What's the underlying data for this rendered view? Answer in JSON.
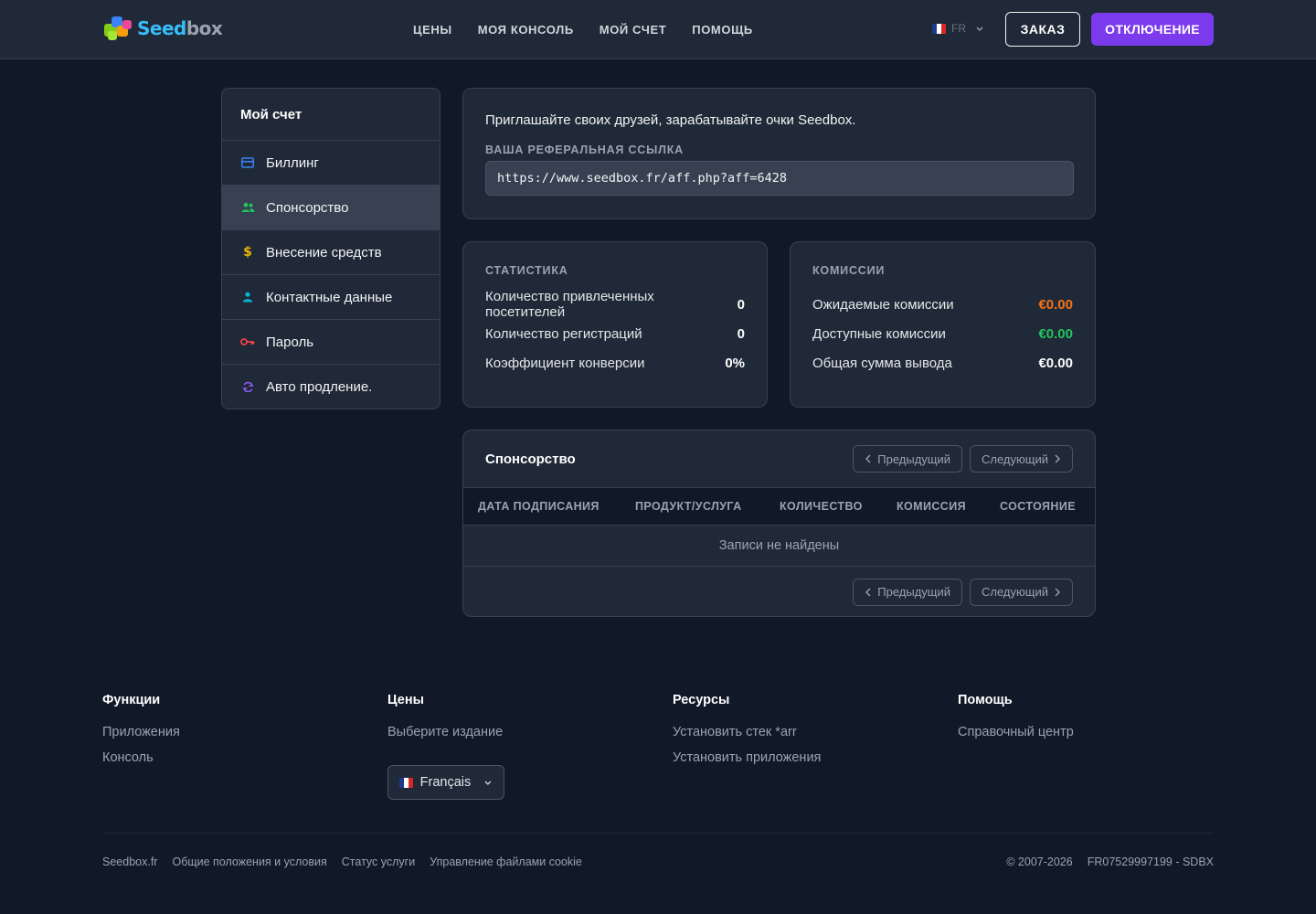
{
  "header": {
    "logo_text_a": "Seed",
    "logo_text_b": "box",
    "nav": [
      "ЦЕНЫ",
      "МОЯ КОНСОЛЬ",
      "МОЙ СЧЕТ",
      "ПОМОЩЬ"
    ],
    "lang": "FR",
    "order_button": "ЗАКАЗ",
    "logout_button": "ОТКЛЮЧЕНИЕ"
  },
  "sidebar": {
    "title": "Мой счет",
    "items": [
      {
        "label": "Биллинг",
        "icon": "credit-card-icon",
        "color": "#3b82f6"
      },
      {
        "label": "Спонсорство",
        "icon": "users-icon",
        "color": "#22c55e"
      },
      {
        "label": "Внесение средств",
        "icon": "dollar-icon",
        "color": "#eab308"
      },
      {
        "label": "Контактные данные",
        "icon": "user-icon",
        "color": "#06b6d4"
      },
      {
        "label": "Пароль",
        "icon": "key-icon",
        "color": "#ef4444"
      },
      {
        "label": "Авто продление.",
        "icon": "refresh-icon",
        "color": "#8b5cf6"
      }
    ],
    "active_index": 1
  },
  "referral": {
    "text": "Приглашайте своих друзей, зарабатывайте очки Seedbox.",
    "label": "ВАША РЕФЕРАЛЬНАЯ ССЫЛКА",
    "link": "https://www.seedbox.fr/aff.php?aff=6428"
  },
  "stats": {
    "title": "СТАТИСТИКА",
    "rows": [
      {
        "label": "Количество привлеченных посетителей",
        "value": "0"
      },
      {
        "label": "Количество регистраций",
        "value": "0"
      },
      {
        "label": "Коэффициент конверсии",
        "value": "0%"
      }
    ]
  },
  "commissions": {
    "title": "КОМИССИИ",
    "rows": [
      {
        "label": "Ожидаемые комиссии",
        "value": "€0.00",
        "color": "#f97316"
      },
      {
        "label": "Доступные комиссии",
        "value": "€0.00",
        "color": "#22c55e"
      },
      {
        "label": "Общая сумма вывода",
        "value": "€0.00",
        "color": "#ffffff"
      }
    ]
  },
  "sponsorship": {
    "title": "Спонсорство",
    "prev": "Предыдущий",
    "next": "Следующий",
    "columns": [
      "ДАТА ПОДПИСАНИЯ",
      "ПРОДУКТ/УСЛУГА",
      "КОЛИЧЕСТВО",
      "КОМИССИЯ",
      "СОСТОЯНИЕ"
    ],
    "empty": "Записи не найдены"
  },
  "footer": {
    "columns": [
      {
        "title": "Функции",
        "links": [
          "Приложения",
          "Консоль"
        ]
      },
      {
        "title": "Цены",
        "links": [
          "Выберите издание"
        ]
      },
      {
        "title": "Ресурсы",
        "links": [
          "Установить стек *arr",
          "Установить приложения"
        ]
      },
      {
        "title": "Помощь",
        "links": [
          "Справочный центр"
        ]
      }
    ],
    "language": "Français",
    "bottom_links": [
      "Seedbox.fr",
      "Общие положения и условия",
      "Статус услуги",
      "Управление файлами cookie"
    ],
    "copyright": "© 2007-2026",
    "company_id": "FR07529997199 - SDBX"
  }
}
